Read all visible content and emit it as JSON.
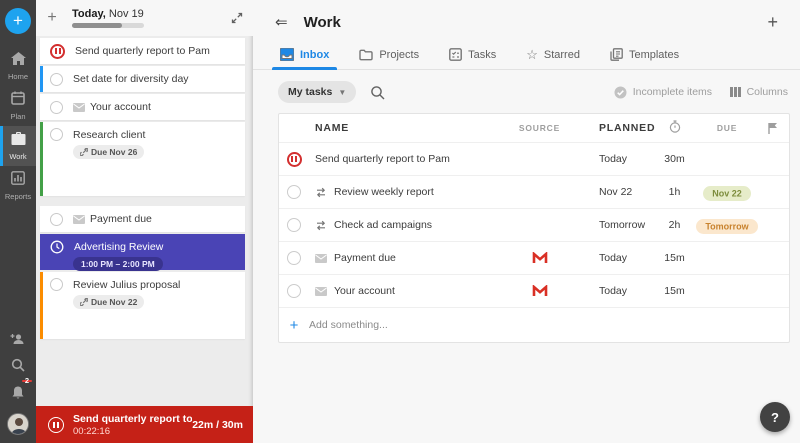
{
  "colors": {
    "accent_blue": "#1e88e5",
    "rail_bg": "#3f3f3f",
    "timer_red": "#c52117",
    "pause_red": "#d32f2f",
    "selected_purple": "#4a44b5",
    "border_blue": "#2196f3",
    "border_green": "#43a047",
    "border_orange": "#fb8c00",
    "due_green_bg": "#e6ecc9",
    "due_green_text": "#7c8c3c",
    "due_orange_bg": "#fbe7cd",
    "due_orange_text": "#c8822e"
  },
  "sidebar": {
    "add_label": "+",
    "items": [
      {
        "label": "Home"
      },
      {
        "label": "Plan"
      },
      {
        "label": "Work",
        "active": true
      },
      {
        "label": "Reports"
      }
    ],
    "notifications_badge": "2",
    "bottom_icons": [
      "invite-icon",
      "search-icon",
      "bell-icon",
      "avatar"
    ]
  },
  "panel": {
    "header": {
      "title_bold": "Today,",
      "title_rest": "Nov 19",
      "progress_pct": 70
    },
    "tasks": [
      {
        "name": "Send quarterly report to Pam",
        "icon": "pause"
      },
      {
        "name": "Set date for diversity day",
        "icon": "circle",
        "border": "blue"
      },
      {
        "name": "Your account",
        "icon": "circle",
        "mail": true
      },
      {
        "name": "Research client",
        "icon": "circle",
        "border": "green",
        "chip": "Due Nov 26"
      },
      {
        "name": "Payment due",
        "icon": "circle",
        "mail": true
      },
      {
        "name": "Advertising Review",
        "icon": "clock",
        "selected": true,
        "time": "1:00 PM – 2:00 PM"
      },
      {
        "name": "Review Julius proposal",
        "icon": "circle",
        "border": "orange",
        "chip": "Due Nov 22"
      }
    ],
    "timer": {
      "task": "Send quarterly report to Pam",
      "elapsed": "00:22:16",
      "ratio": "22m / 30m"
    }
  },
  "main": {
    "title": "Work",
    "add_label": "+",
    "tabs": [
      {
        "label": "Inbox",
        "active": true
      },
      {
        "label": "Projects"
      },
      {
        "label": "Tasks"
      },
      {
        "label": "Starred"
      },
      {
        "label": "Templates"
      }
    ],
    "toolbar": {
      "filter_label": "My tasks",
      "incomplete_label": "Incomplete items",
      "columns_label": "Columns"
    },
    "table": {
      "headers": {
        "name": "NAME",
        "source": "SOURCE",
        "planned": "PLANNED",
        "due": "DUE"
      },
      "rows": [
        {
          "name": "Send quarterly report to Pam",
          "icon": "pause",
          "planned": "Today",
          "duration": "30m",
          "due": "",
          "source": ""
        },
        {
          "name": "Review weekly report",
          "icon": "circle",
          "repeat": true,
          "planned": "Nov 22",
          "duration": "1h",
          "due": "Nov 22",
          "due_style": "green",
          "source": ""
        },
        {
          "name": "Check ad campaigns",
          "icon": "circle",
          "repeat": true,
          "planned": "Tomorrow",
          "duration": "2h",
          "due": "Tomorrow",
          "due_style": "orange",
          "source": ""
        },
        {
          "name": "Payment due",
          "icon": "circle",
          "mail": true,
          "planned": "Today",
          "duration": "15m",
          "due": "",
          "source": "gmail"
        },
        {
          "name": "Your account",
          "icon": "circle",
          "mail": true,
          "planned": "Today",
          "duration": "15m",
          "due": "",
          "source": "gmail"
        }
      ],
      "add_label": "Add something..."
    },
    "help_label": "?"
  }
}
